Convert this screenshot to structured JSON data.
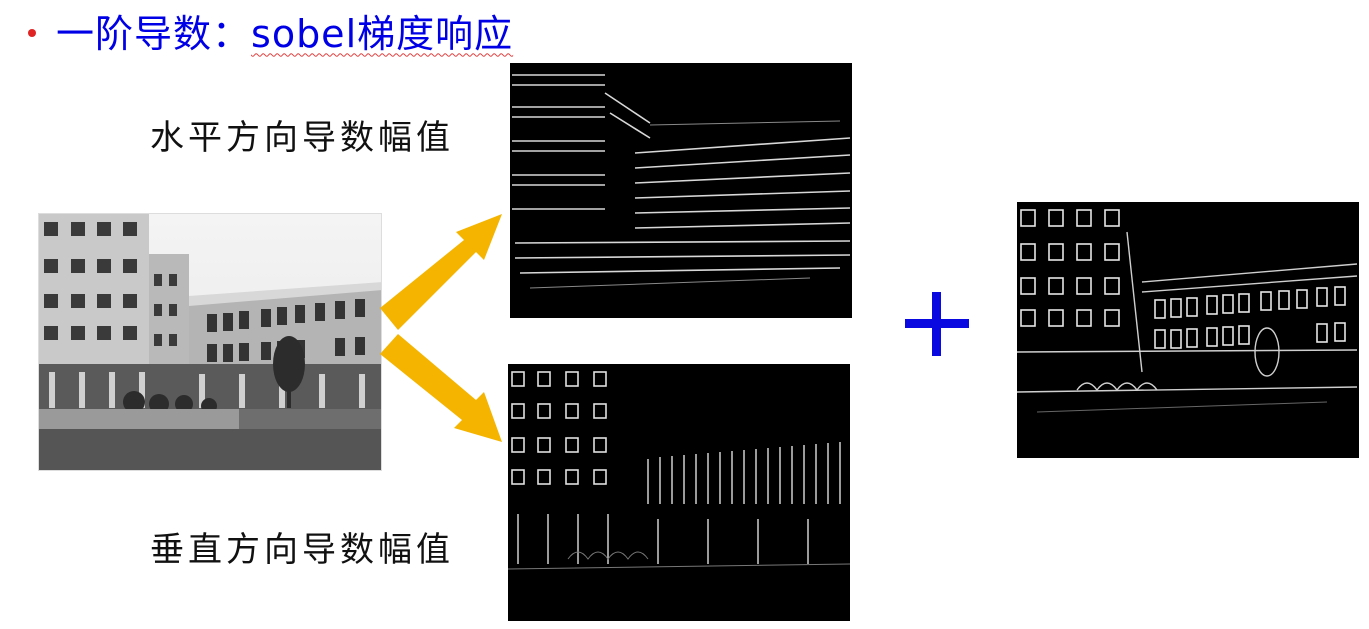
{
  "slide": {
    "title_prefix": "一阶导数：",
    "title_keyword": "sobel梯度响应",
    "bullet_color": "#e02424",
    "title_color": "#0000e6"
  },
  "labels": {
    "horizontal": "水平方向导数幅值",
    "vertical": "垂直方向导数幅值"
  },
  "images": {
    "source": "grayscale building photo",
    "horizontal_gradient": "horizontal sobel response",
    "vertical_gradient": "vertical sobel response",
    "combined_gradient": "combined sobel response"
  },
  "symbols": {
    "operator": "plus",
    "arrow_color": "#f4b400",
    "operator_color": "#0a0ae0"
  }
}
